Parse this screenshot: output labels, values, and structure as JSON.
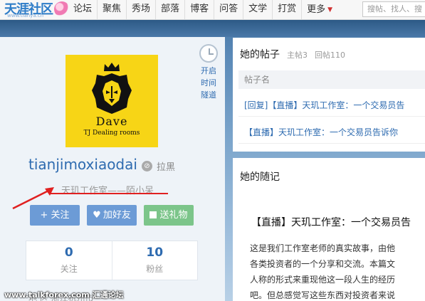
{
  "header": {
    "logo_text": "天涯社区",
    "logo_sub": "www.tianya.cn",
    "nav": [
      "论坛",
      "聚焦",
      "秀场",
      "部落",
      "博客",
      "问答",
      "文学",
      "打赏",
      "更多"
    ],
    "search_placeholder": "搜帖、找人、搜"
  },
  "profile": {
    "username": "tianjimoxiaodai",
    "block_label": "拉黑",
    "motto": "天玑工作室——陌小呆",
    "avatar_text": {
      "name": "Dave",
      "tagline": "TJ Dealing rooms"
    },
    "timeline_label": [
      "开启",
      "时间",
      "隧道"
    ],
    "buttons": {
      "follow": "+ 关注",
      "friend": "加好友",
      "gift": "送礼物"
    },
    "stats": {
      "following": {
        "value": "0",
        "label": "关注"
      },
      "fans": {
        "value": "10",
        "label": "粉丝"
      }
    },
    "location_partial": "地    区 浙江杭州市"
  },
  "posts": {
    "title": "她的帖子",
    "main_count": "主帖3",
    "reply_count": "回帖110",
    "column_header": "帖子名",
    "items": [
      "[回复]【直播】天玑工作室：一个交易员告",
      "【直播】天玑工作室：一个交易员告诉你"
    ]
  },
  "diary": {
    "title": "她的随记",
    "post_title": "【直播】天玑工作室：一个交易员告",
    "lines": [
      "这是我们工作室老师的真实故事，由他",
      "各类投资者的一个分享和交流。本篇文",
      "人称的形式来重现他这一段人生的经历",
      "吧。但总感觉写这些东西对投资者来说"
    ]
  },
  "watermark": "www.talkforex.com 汇通论坛",
  "colors": {
    "accent": "#2e6bb0",
    "follow_btn": "#6c9bd6",
    "gift_btn": "#7cc58a",
    "annotation": "#e02020"
  }
}
